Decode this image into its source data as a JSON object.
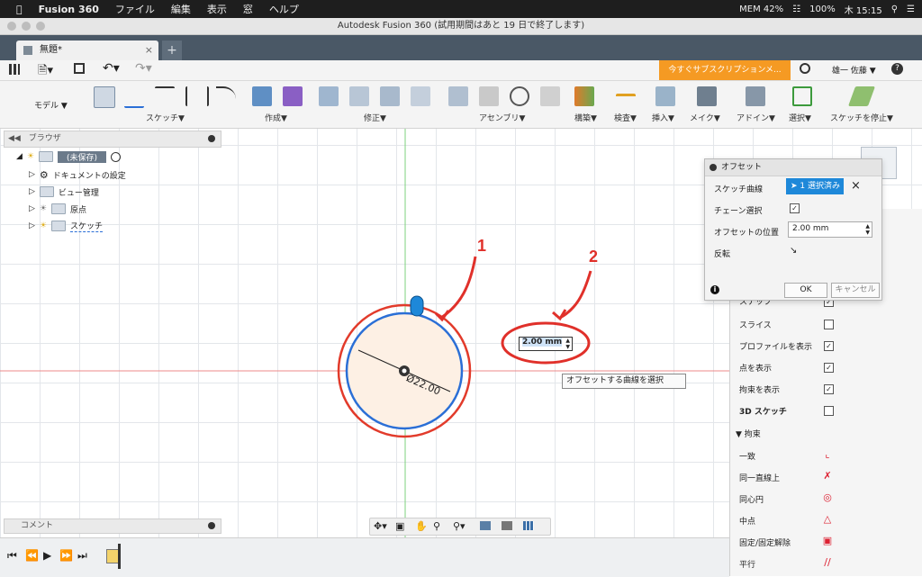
{
  "menubar": {
    "app_name": "Fusion 360",
    "items": [
      "ファイル",
      "編集",
      "表示",
      "窓",
      "ヘルプ"
    ],
    "battery": "100%",
    "memory": "MEM 42%",
    "clock": "木 15:15"
  },
  "window": {
    "title": "Autodesk Fusion 360 (試用期間はあと 19 日で終了します)"
  },
  "tab": {
    "label": "無題*",
    "plus": "+"
  },
  "quickbar": {
    "trial_label": "今すぐサブスクリプションメ...",
    "user_name": "雄一 佐藤 ▼",
    "help": "?"
  },
  "ribbon": {
    "workspace": "モデル ▼",
    "groups": [
      "スケッチ▼",
      "作成▼",
      "修正▼",
      "アセンブリ▼",
      "構築▼",
      "検査▼",
      "挿入▼",
      "メイク▼",
      "アドイン▼",
      "選択▼",
      "スケッチを停止▼"
    ]
  },
  "browser": {
    "title": "ブラウザ",
    "items": [
      {
        "label": "(未保存)"
      },
      {
        "label": "ドキュメントの設定"
      },
      {
        "label": "ビュー管理"
      },
      {
        "label": "原点"
      },
      {
        "label": "スケッチ"
      }
    ]
  },
  "sketch": {
    "dimension": "Ø22.00",
    "inline_offset": "2.00 mm",
    "tooltip": "オフセットする曲線を選択",
    "annotation_1": "1",
    "annotation_2": "2"
  },
  "offset_dialog": {
    "title": "オフセット",
    "rows": {
      "curve_label": "スケッチ曲線",
      "curve_value": "1 選択済み",
      "chain_label": "チェーン選択",
      "position_label": "オフセットの位置",
      "position_value": "2.00 mm",
      "flip_label": "反転"
    },
    "ok": "OK",
    "cancel": "キャンセル"
  },
  "palette": {
    "top_partial": "スナップ",
    "options": [
      {
        "label": "スライス",
        "checked": false
      },
      {
        "label": "プロファイルを表示",
        "checked": true
      },
      {
        "label": "点を表示",
        "checked": true
      },
      {
        "label": "拘束を表示",
        "checked": true
      },
      {
        "label": "3D スケッチ",
        "checked": false
      }
    ],
    "constraints_header": "▼ 拘束",
    "constraints": [
      "一致",
      "同一直線上",
      "同心円",
      "中点",
      "固定/固定解除",
      "平行"
    ]
  },
  "comment": {
    "label": "コメント"
  },
  "colors": {
    "accent": "#f59a23",
    "selection": "#1e88d9",
    "annotation": "#e0302a",
    "circle_inner": "#2b6fd6"
  }
}
